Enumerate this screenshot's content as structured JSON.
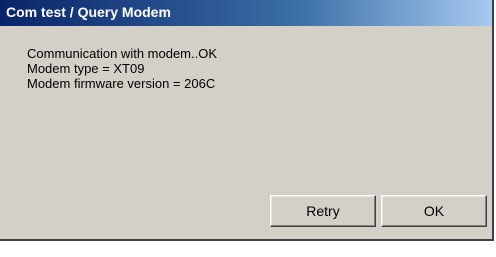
{
  "window": {
    "title": "Com test / Query Modem"
  },
  "message": {
    "lines": [
      "Communication with modem..OK",
      "Modem type = XT09",
      "Modem firmware version = 206C"
    ]
  },
  "buttons": {
    "retry_label": "Retry",
    "ok_label": "OK"
  },
  "colors": {
    "titlebar_start": "#0a246a",
    "titlebar_end": "#a6caf0",
    "dialog_background": "#d4d0c8"
  }
}
